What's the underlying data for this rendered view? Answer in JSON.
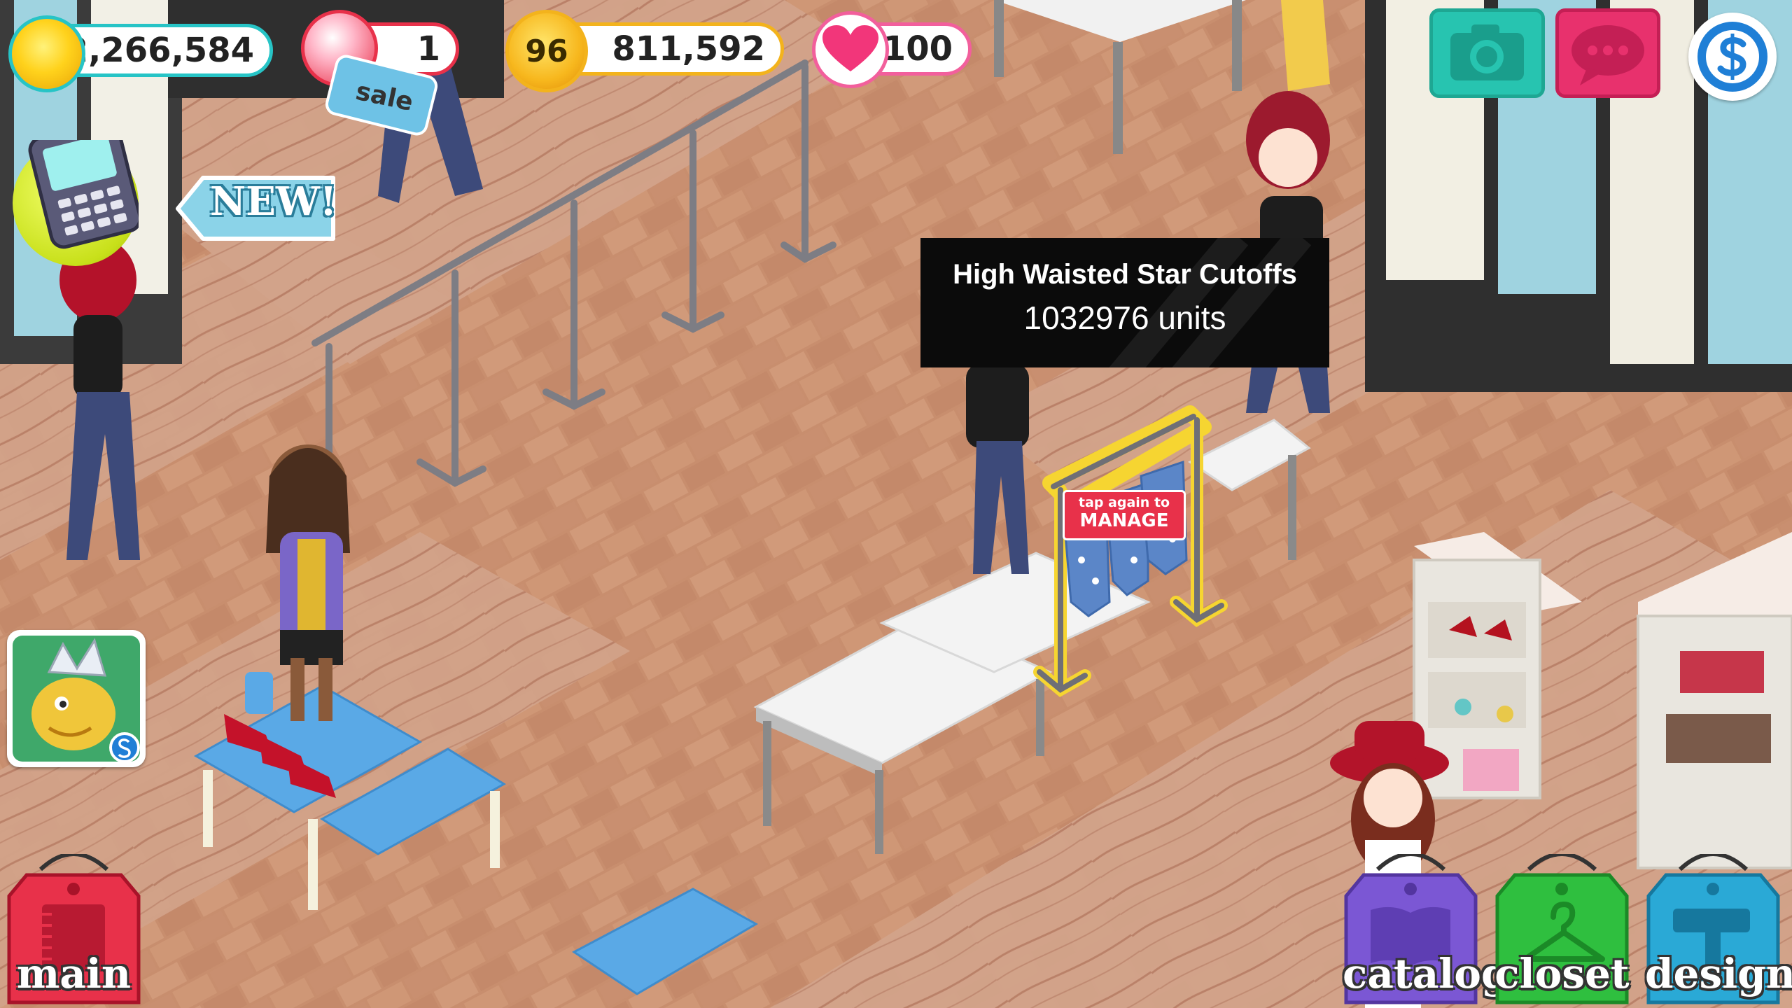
{
  "hud": {
    "coins": "2,266,584",
    "gems": "1",
    "level": "96",
    "xp": "811,592",
    "hearts": "100",
    "sale_tag": "sale",
    "new_badge": "NEW!"
  },
  "tooltip": {
    "item_name": "High Waisted Star Cutoffs",
    "units": "1032976 units"
  },
  "rack_prompt": {
    "line1": "tap again to",
    "line2": "MANAGE"
  },
  "bottom_tabs": [
    {
      "label": "main",
      "icon": "notebook-icon",
      "color": "#e8314a"
    },
    {
      "label": "catalog",
      "icon": "book-icon",
      "color": "#7b57d4"
    },
    {
      "label": "closet",
      "icon": "hanger-icon",
      "color": "#2fbf3f"
    },
    {
      "label": "design",
      "icon": "hammer-icon",
      "color": "#2aa9d6"
    }
  ],
  "top_buttons": [
    {
      "name": "camera-button",
      "icon": "camera-icon",
      "color": "#27c4b0"
    },
    {
      "name": "chat-button",
      "icon": "chat-bubble-icon",
      "color": "#e8316d"
    },
    {
      "name": "storm8-button",
      "icon": "storm8-logo-icon",
      "color": "#1f7fd6"
    }
  ],
  "colors": {
    "accent_teal": "#27c4c6",
    "floor": "#c98f6f",
    "tooltip_bg": "#0b0b0b"
  }
}
